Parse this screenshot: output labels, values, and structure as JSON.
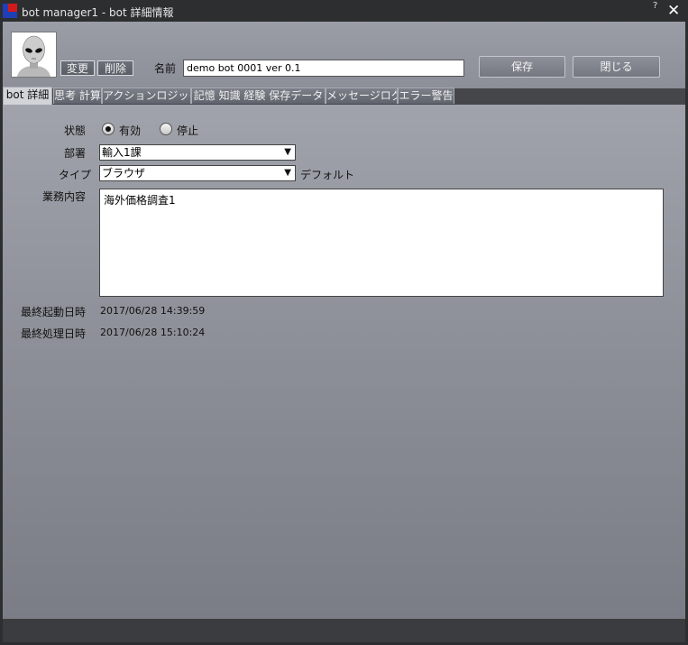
{
  "window": {
    "title": "bot manager1 - bot 詳細情報",
    "help": "?",
    "close": "✕"
  },
  "header": {
    "change_label": "変更",
    "delete_label": "削除",
    "name_label": "名前",
    "name_value": "demo bot 0001 ver 0.1",
    "save_label": "保存",
    "close_label": "閉じる"
  },
  "tabs": [
    {
      "label": "bot 詳細",
      "active": true
    },
    {
      "label": "思考 計算",
      "active": false
    },
    {
      "label": "アクションロジック",
      "active": false
    },
    {
      "label": "記憶 知識 経験 保存データ",
      "active": false
    },
    {
      "label": "メッセージログ",
      "active": false
    },
    {
      "label": "エラー警告",
      "active": false
    }
  ],
  "form": {
    "status_label": "状態",
    "status_enabled": "有効",
    "status_stopped": "停止",
    "status_selected": "有効",
    "dept_label": "部署",
    "dept_value": "輸入1課",
    "type_label": "タイプ",
    "type_value": "ブラウザ",
    "type_default": "デフォルト",
    "task_label": "業務内容",
    "task_value": "海外価格調査1",
    "last_start_label": "最終起動日時",
    "last_start_value": "2017/06/28 14:39:59",
    "last_process_label": "最終処理日時",
    "last_process_value": "2017/06/28 15:10:24"
  },
  "colors": {
    "accent_red": "#d21a1a",
    "accent_blue": "#1f3fb6"
  }
}
